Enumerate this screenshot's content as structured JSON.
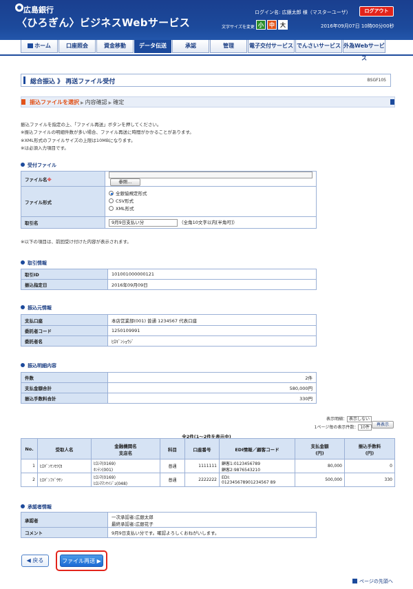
{
  "header": {
    "bank_name": "広島銀行",
    "service_name": "〈ひろぎん〉ビジネスWebサービス",
    "login_name": "ログイン名: 広銀太郎 様（マスターユーザ）",
    "logout_label": "ログアウト",
    "font_size_label": "文字サイズを変更",
    "font_small": "小",
    "font_medium": "中",
    "font_large": "大",
    "datetime": "2016年09月07日 10時00分00秒"
  },
  "nav": {
    "items": [
      {
        "label": "ホーム"
      },
      {
        "label": "口座照会"
      },
      {
        "label": "資金移動"
      },
      {
        "label": "データ伝送"
      },
      {
        "label": "承認"
      },
      {
        "label": "管理"
      },
      {
        "label": "電子交付サービス"
      },
      {
        "label": "でんさいサービス"
      },
      {
        "label": "外為Webサービス"
      }
    ],
    "active_index": 3
  },
  "page": {
    "title": "総合振込 》 再送ファイル受付",
    "code": "BSGF105"
  },
  "steps": {
    "current": "振込ファイルを選択",
    "confirm": "内容確認",
    "done": "確定"
  },
  "instructions": [
    "振込ファイルを指定の上、「ファイル再送」ボタンを押してください。",
    "※振込ファイルの明細件数が多い場合、ファイル再送に時間がかかることがあります。",
    "※XML形式のファイルサイズの上限は10MBになります。",
    "※は必須入力項目です。"
  ],
  "receive_file": {
    "section_title": "受付ファイル",
    "file_name_label": "ファイル名",
    "required_mark": "※",
    "browse_label": "参照...",
    "file_format_label": "ファイル形式",
    "formats": [
      "全銀協規定形式",
      "CSV形式",
      "XML形式"
    ],
    "selected_format": 0,
    "transaction_name_label": "取引名",
    "transaction_name_value": "9月9日支払い分",
    "transaction_name_hint": "（全角10文字以内[半角可]）"
  },
  "prev_note": "※以下の項目は、前回受け付けた内容が表示されます。",
  "transaction_info": {
    "section_title": "取引情報",
    "rows": [
      {
        "label": "取引ID",
        "value": "101001000000121"
      },
      {
        "label": "振込指定日",
        "value": "2016年09月09日"
      }
    ]
  },
  "source_info": {
    "section_title": "振込元情報",
    "rows": [
      {
        "label": "支払口座",
        "value": "本店営業部(001) 普通 1234567 代表口座"
      },
      {
        "label": "委託者コード",
        "value": "1250109991"
      },
      {
        "label": "委託者名",
        "value": "ﾋﾛｷﾞﾝｼｮｳｼﾞ"
      }
    ]
  },
  "detail_info": {
    "section_title": "振込明細内容",
    "rows": [
      {
        "label": "件数",
        "value": "2件"
      },
      {
        "label": "支払金額合計",
        "value": "580,000円"
      },
      {
        "label": "振込手数料合計",
        "value": "330円"
      }
    ]
  },
  "list_controls": {
    "display_label": "表示明細：",
    "display_select": "表示しない",
    "per_page_label": "1ページ毎の表示件数：",
    "per_page_select": "10件",
    "redisplay_label": "再表示",
    "count_text": "全2件(1〜2件を表示中)"
  },
  "detail_table": {
    "headers": [
      "No.",
      "受取人名",
      "金融機関名\n支店名",
      "科目",
      "口座番号",
      "EDI情報／顧客コード",
      "支払金額\n(円)",
      "振込手数料\n(円)"
    ],
    "rows": [
      {
        "no": "1",
        "payee": "ﾋﾛｷﾞﾝｹﾝｾﾂ(ｶ",
        "bank": "ﾋﾛｼﾏ(0169)",
        "branch": "ﾎﾝﾃﾝ(001)",
        "type": "普通",
        "account": "1111111",
        "edi1": "顧客1:0123456789",
        "edi2": "顧客2:9876543210",
        "amount": "80,000",
        "fee": "0"
      },
      {
        "no": "2",
        "payee": "ﾋﾛｷﾞﾝﾌﾄﾞｳｻﾝ",
        "bank": "ﾋﾛｼﾏ(0169)",
        "branch": "ﾋﾛｼﾏﾏﾝｹｲｼﾞｮ(048)",
        "type": "普通",
        "account": "2222222",
        "edi1": "EDI:",
        "edi2": "012345678901234567 89",
        "amount": "500,000",
        "fee": "330"
      }
    ]
  },
  "approver_info": {
    "section_title": "承認者情報",
    "approver_label": "承認者",
    "approver_line1": "一次承認者:広銀太郎",
    "approver_line2": "最終承認者:広銀花子",
    "comment_label": "コメント",
    "comment_value": "9月9日支払い分です。確認よろしくおねがいします。"
  },
  "buttons": {
    "back": "戻る",
    "resend": "ファイル再送"
  },
  "to_top": "ページの先頭へ"
}
